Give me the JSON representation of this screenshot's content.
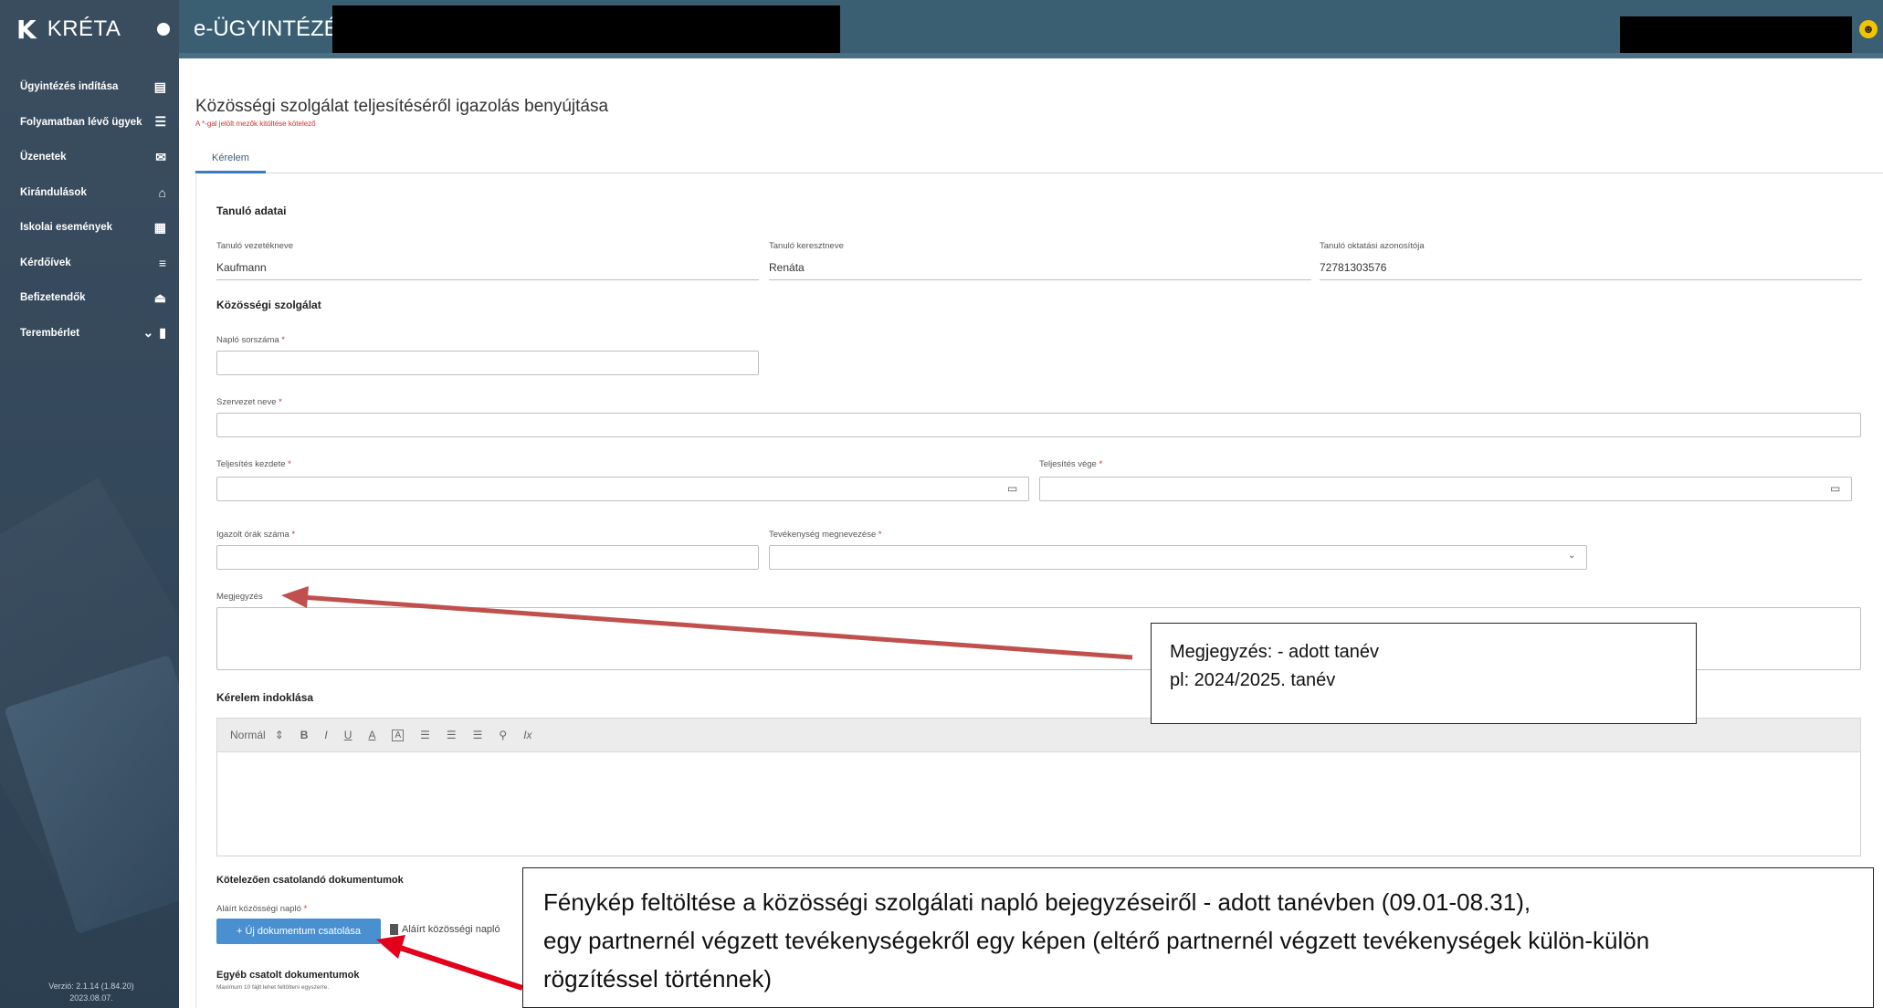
{
  "sidebar": {
    "logo_glyph": "K",
    "brand": "KRÉTA",
    "items": [
      {
        "label": "Ügyintézés indítása",
        "icon": "document-icon",
        "glyph": "▤"
      },
      {
        "label": "Folyamatban lévő ügyek",
        "icon": "list-icon",
        "glyph": "☰"
      },
      {
        "label": "Üzenetek",
        "icon": "envelope-icon",
        "glyph": "✉"
      },
      {
        "label": "Kirándulások",
        "icon": "bed-icon",
        "glyph": "⌂"
      },
      {
        "label": "Iskolai események",
        "icon": "calendar-icon",
        "glyph": "▦"
      },
      {
        "label": "Kérdőívek",
        "icon": "lines-icon",
        "glyph": "≡"
      },
      {
        "label": "Befizetendők",
        "icon": "bank-icon",
        "glyph": "⏏"
      },
      {
        "label": "Terembérlet",
        "icon": "door-icon",
        "glyph": "▮",
        "chevron": "⌄"
      }
    ],
    "version_line1": "Verzió: 2.1.14 (1.84.20)",
    "version_line2": "2023.08.07."
  },
  "header": {
    "title": "e-ÜGYINTÉZÉS –",
    "user_icon_glyph": "☻"
  },
  "page": {
    "title": "Közösségi szolgálat teljesítéséről igazolás benyújtása",
    "required_note": "A *-gal jelölt mezők kitöltése kötelező",
    "tab": "Kérelem"
  },
  "form": {
    "student_section": "Tanuló adatai",
    "last_name_label": "Tanuló vezetékneve",
    "last_name_value": "Kaufmann",
    "first_name_label": "Tanuló keresztneve",
    "first_name_value": "Renáta",
    "id_label": "Tanuló oktatási azonosítója",
    "id_value": "72781303576",
    "service_section": "Közösségi szolgálat",
    "journal_label": "Napló sorszáma",
    "org_label": "Szervezet neve",
    "start_label": "Teljesítés kezdete",
    "end_label": "Teljesítés vége",
    "hours_label": "Igazolt órák száma",
    "activity_label": "Tevékenység megnevezése",
    "note_label": "Megjegyzés",
    "reason_section": "Kérelem indoklása",
    "required_mark": "*",
    "calendar_glyph": "▭",
    "select_caret": "⌄"
  },
  "toolbar": {
    "style": "Normál",
    "style_caret": "⇕",
    "bold": "B",
    "italic": "I",
    "underline": "U",
    "font_color": "A",
    "bg_color": "A",
    "ordered_list": "☰",
    "bullet_list": "☰",
    "align": "☰",
    "link": "⚲",
    "clear": "Ix"
  },
  "docs": {
    "section": "Kötelezően csatolandó dokumentumok",
    "signed_label": "Aláírt közösségi napló",
    "upload_button": "+ Új dokumentum csatolása",
    "signed_link": "Aláírt közösségi napló",
    "other_section": "Egyéb csatolt dokumentumok",
    "other_note": "Maximum 10 fájlt lehet feltölteni egyszerre."
  },
  "callouts": {
    "note_line1": "Megjegyzés: - adott tanév",
    "note_line2": "pl: 2024/2025. tanév",
    "photo_line1": "Fénykép feltöltése a közösségi szolgálati napló bejegyzéseiről - adott tanévben (09.01-08.31),",
    "photo_line2": "egy partnernél végzett tevékenységekről egy képen (eltérő partnernél végzett tevékenységek külön-külön",
    "photo_line3": "rögzítéssel történnek)"
  },
  "colors": {
    "sidebar": "#3a4d5f",
    "header": "#3a5f73",
    "accent": "#4a90d0",
    "required": "#d32f2f",
    "arrow": "#c62828"
  }
}
